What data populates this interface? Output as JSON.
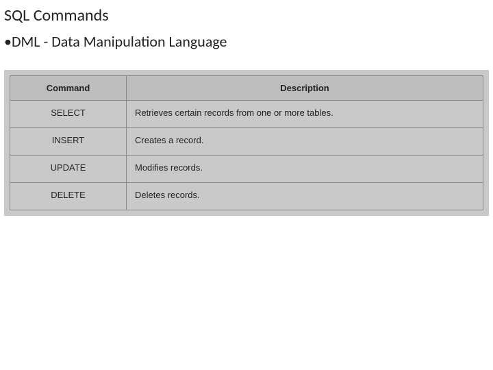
{
  "title": "SQL Commands",
  "subtitle": "•DML - Data Manipulation Language",
  "table": {
    "headers": {
      "command": "Command",
      "description": "Description"
    },
    "rows": [
      {
        "command": "SELECT",
        "description": "Retrieves certain records from one or more tables."
      },
      {
        "command": "INSERT",
        "description": "Creates a record."
      },
      {
        "command": "UPDATE",
        "description": "Modifies records."
      },
      {
        "command": "DELETE",
        "description": "Deletes records."
      }
    ]
  }
}
